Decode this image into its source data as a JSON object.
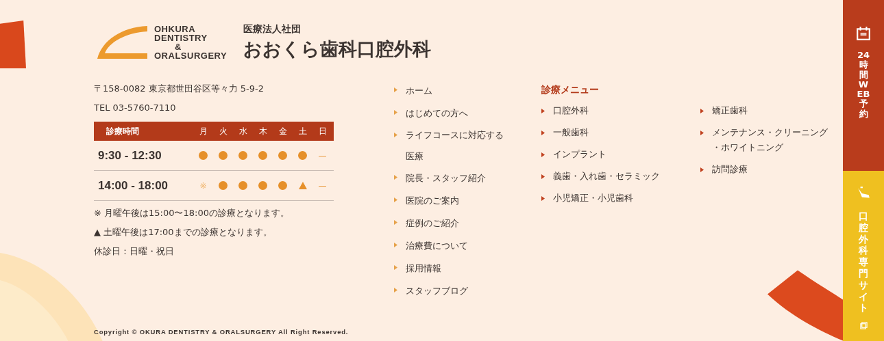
{
  "logo": {
    "lines": [
      "OHKURA",
      "DENTISTRY",
      "&",
      "ORALSURGERY"
    ],
    "subtitle": "医療法人社団",
    "name": "おおくら歯科口腔外科"
  },
  "address": "〒158-0082 東京都世田谷区等々力 5-9-2",
  "tel": "TEL 03-5760-7110",
  "schedule": {
    "header": "診療時間",
    "days": [
      "月",
      "火",
      "水",
      "木",
      "金",
      "土",
      "日"
    ],
    "rows": [
      {
        "time": "9:30 - 12:30",
        "cells": [
          {
            "kind": "open"
          },
          {
            "kind": "open"
          },
          {
            "kind": "open"
          },
          {
            "kind": "open"
          },
          {
            "kind": "open"
          },
          {
            "kind": "open"
          },
          {
            "kind": "closed",
            "symbol": "—"
          }
        ]
      },
      {
        "time": "14:00 - 18:00",
        "cells": [
          {
            "kind": "note",
            "symbol": "※"
          },
          {
            "kind": "open"
          },
          {
            "kind": "open"
          },
          {
            "kind": "open"
          },
          {
            "kind": "open"
          },
          {
            "kind": "partial"
          },
          {
            "kind": "closed",
            "symbol": "—"
          }
        ]
      }
    ]
  },
  "notes": [
    "※ 月曜午後は15:00〜18:00の診療となります。",
    "▲ 土曜午後は17:00までの診療となります。",
    "休診日：日曜・祝日"
  ],
  "nav": [
    "ホーム",
    "はじめての方へ",
    "ライフコースに対応する医療",
    "院長・スタッフ紹介",
    "医院のご案内",
    "症例のご紹介",
    "治療費について",
    "採用情報",
    "スタッフブログ"
  ],
  "menu": {
    "title": "診療メニュー",
    "columns": [
      [
        "口腔外科",
        "一般歯科",
        "インプラント",
        "義歯・入れ歯・セラミック",
        "小児矯正・小児歯科"
      ],
      [
        "矯正歯科",
        "メンテナンス・クリーニング・ホワイトニング",
        "訪問診療"
      ]
    ]
  },
  "copyright": "Copyright © OKURA DENTISTRY & ORALSURGERY All Right Reserved.",
  "side": [
    {
      "kind": "calendar",
      "label": "24時間WEB予約"
    },
    {
      "kind": "chair",
      "label": "口腔外科専門サイト"
    }
  ]
}
